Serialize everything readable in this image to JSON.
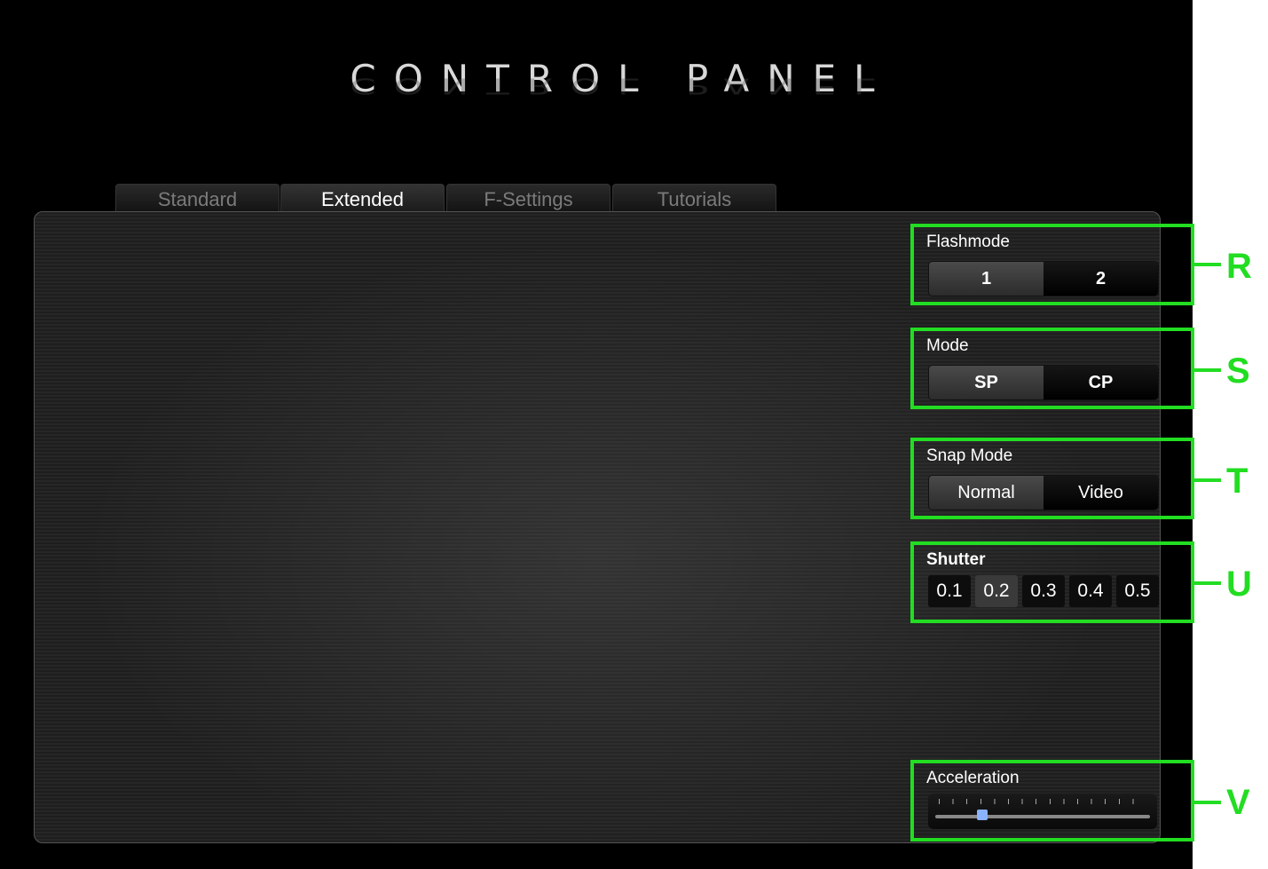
{
  "app": {
    "title": "CONTROL PANEL"
  },
  "tabs": [
    {
      "label": "Standard",
      "active": false
    },
    {
      "label": "Extended",
      "active": true
    },
    {
      "label": "F-Settings",
      "active": false
    },
    {
      "label": "Tutorials",
      "active": false
    }
  ],
  "flashmode": {
    "label": "Flashmode",
    "options": [
      "1",
      "2"
    ],
    "selected": "1",
    "callout": "R"
  },
  "mode": {
    "label": "Mode",
    "options": [
      "SP",
      "CP"
    ],
    "selected": "SP",
    "callout": "S"
  },
  "snap_mode": {
    "label": "Snap Mode",
    "options": [
      "Normal",
      "Video"
    ],
    "selected": "Normal",
    "callout": "T"
  },
  "shutter": {
    "label": "Shutter",
    "options": [
      "0.1",
      "0.2",
      "0.3",
      "0.4",
      "0.5"
    ],
    "selected": "0.2",
    "callout": "U"
  },
  "acceleration": {
    "label": "Acceleration",
    "value_fraction": 0.22,
    "callout": "V"
  },
  "colors": {
    "highlight": "#22dd22",
    "background": "#000000",
    "selected_segment": "#3a3a3a"
  }
}
